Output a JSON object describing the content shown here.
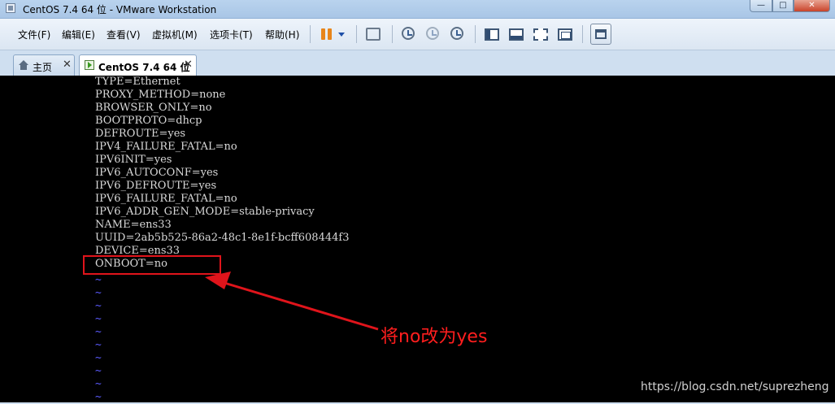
{
  "window": {
    "title": "CentOS 7.4 64 位 - VMware Workstation",
    "minimize": "—",
    "maximize": "□",
    "close": "✕"
  },
  "menu": [
    "文件(F)",
    "编辑(E)",
    "查看(V)",
    "虚拟机(M)",
    "选项卡(T)",
    "帮助(H)"
  ],
  "tabs": [
    {
      "label": "主页",
      "icon": "home-icon",
      "close": "✕"
    },
    {
      "label": "CentOS 7.4 64 位",
      "icon": "vm-icon",
      "close": "✕"
    }
  ],
  "terminal": {
    "lines": [
      "TYPE=Ethernet",
      "PROXY_METHOD=none",
      "BROWSER_ONLY=no",
      "BOOTPROTO=dhcp",
      "DEFROUTE=yes",
      "IPV4_FAILURE_FATAL=no",
      "IPV6INIT=yes",
      "IPV6_AUTOCONF=yes",
      "IPV6_DEFROUTE=yes",
      "IPV6_FAILURE_FATAL=no",
      "IPV6_ADDR_GEN_MODE=stable-privacy",
      "NAME=ens33",
      "UUID=2ab5b525-86a2-48c1-8e1f-bcff608444f3",
      "DEVICE=ens33",
      "ONBOOT=no"
    ],
    "tilde": "~",
    "tilde_count": 10
  },
  "annotation": {
    "text": "将no改为yes",
    "color": "#ff1e1e"
  },
  "watermark": "https://blog.csdn.net/suprezheng",
  "colors": {
    "terminal_bg": "#000000",
    "terminal_fg": "#d9d9d9",
    "tilde": "#5b5bff",
    "annotation": "#e0141b"
  }
}
